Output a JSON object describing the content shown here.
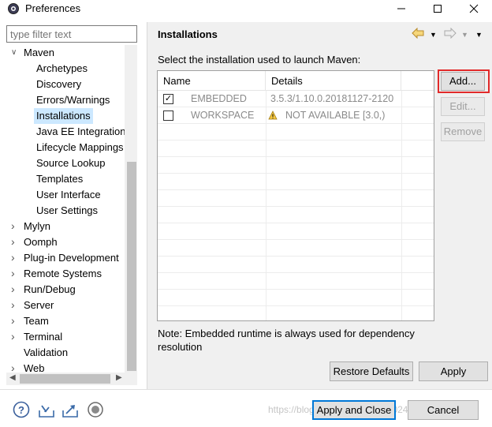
{
  "window": {
    "title": "Preferences",
    "icon": "gear-icon"
  },
  "left": {
    "filter_placeholder": "type filter text",
    "tree": [
      {
        "label": "Maven",
        "level": 0,
        "expanded": true
      },
      {
        "label": "Archetypes",
        "level": 1
      },
      {
        "label": "Discovery",
        "level": 1
      },
      {
        "label": "Errors/Warnings",
        "level": 1
      },
      {
        "label": "Installations",
        "level": 1,
        "selected": true
      },
      {
        "label": "Java EE Integration",
        "level": 1
      },
      {
        "label": "Lifecycle Mappings",
        "level": 1
      },
      {
        "label": "Source Lookup",
        "level": 1
      },
      {
        "label": "Templates",
        "level": 1
      },
      {
        "label": "User Interface",
        "level": 1
      },
      {
        "label": "User Settings",
        "level": 1
      },
      {
        "label": "Mylyn",
        "level": 0,
        "collapsed": true
      },
      {
        "label": "Oomph",
        "level": 0,
        "collapsed": true
      },
      {
        "label": "Plug-in Development",
        "level": 0,
        "collapsed": true
      },
      {
        "label": "Remote Systems",
        "level": 0,
        "collapsed": true
      },
      {
        "label": "Run/Debug",
        "level": 0,
        "collapsed": true
      },
      {
        "label": "Server",
        "level": 0,
        "collapsed": true
      },
      {
        "label": "Team",
        "level": 0,
        "collapsed": true
      },
      {
        "label": "Terminal",
        "level": 0,
        "collapsed": true
      },
      {
        "label": "Validation",
        "level": 0
      },
      {
        "label": "Web",
        "level": 0,
        "collapsed": true
      }
    ]
  },
  "page": {
    "title": "Installations",
    "intro": "Select the installation used to launch Maven:",
    "columns": [
      "Name",
      "Details"
    ],
    "rows": [
      {
        "checked": true,
        "check_mark": "✓",
        "name": "EMBEDDED",
        "details": "3.5.3/1.10.0.20181127-2120",
        "warning": false
      },
      {
        "checked": false,
        "check_mark": "",
        "name": "WORKSPACE",
        "details": "NOT AVAILABLE [3.0,)",
        "warning": true
      }
    ],
    "side_buttons": {
      "add": "Add...",
      "edit": "Edit...",
      "remove": "Remove"
    },
    "note": "Note: Embedded runtime is always used for dependency resolution",
    "restore_defaults": "Restore Defaults",
    "apply": "Apply"
  },
  "footer": {
    "apply_and_close": "Apply and Close",
    "cancel": "Cancel",
    "watermark": "https://blog.csdn.net/u015590024xzb"
  },
  "colors": {
    "selection": "#cce8ff",
    "highlight_box": "#e12a2a",
    "primary_border": "#0078d7"
  }
}
